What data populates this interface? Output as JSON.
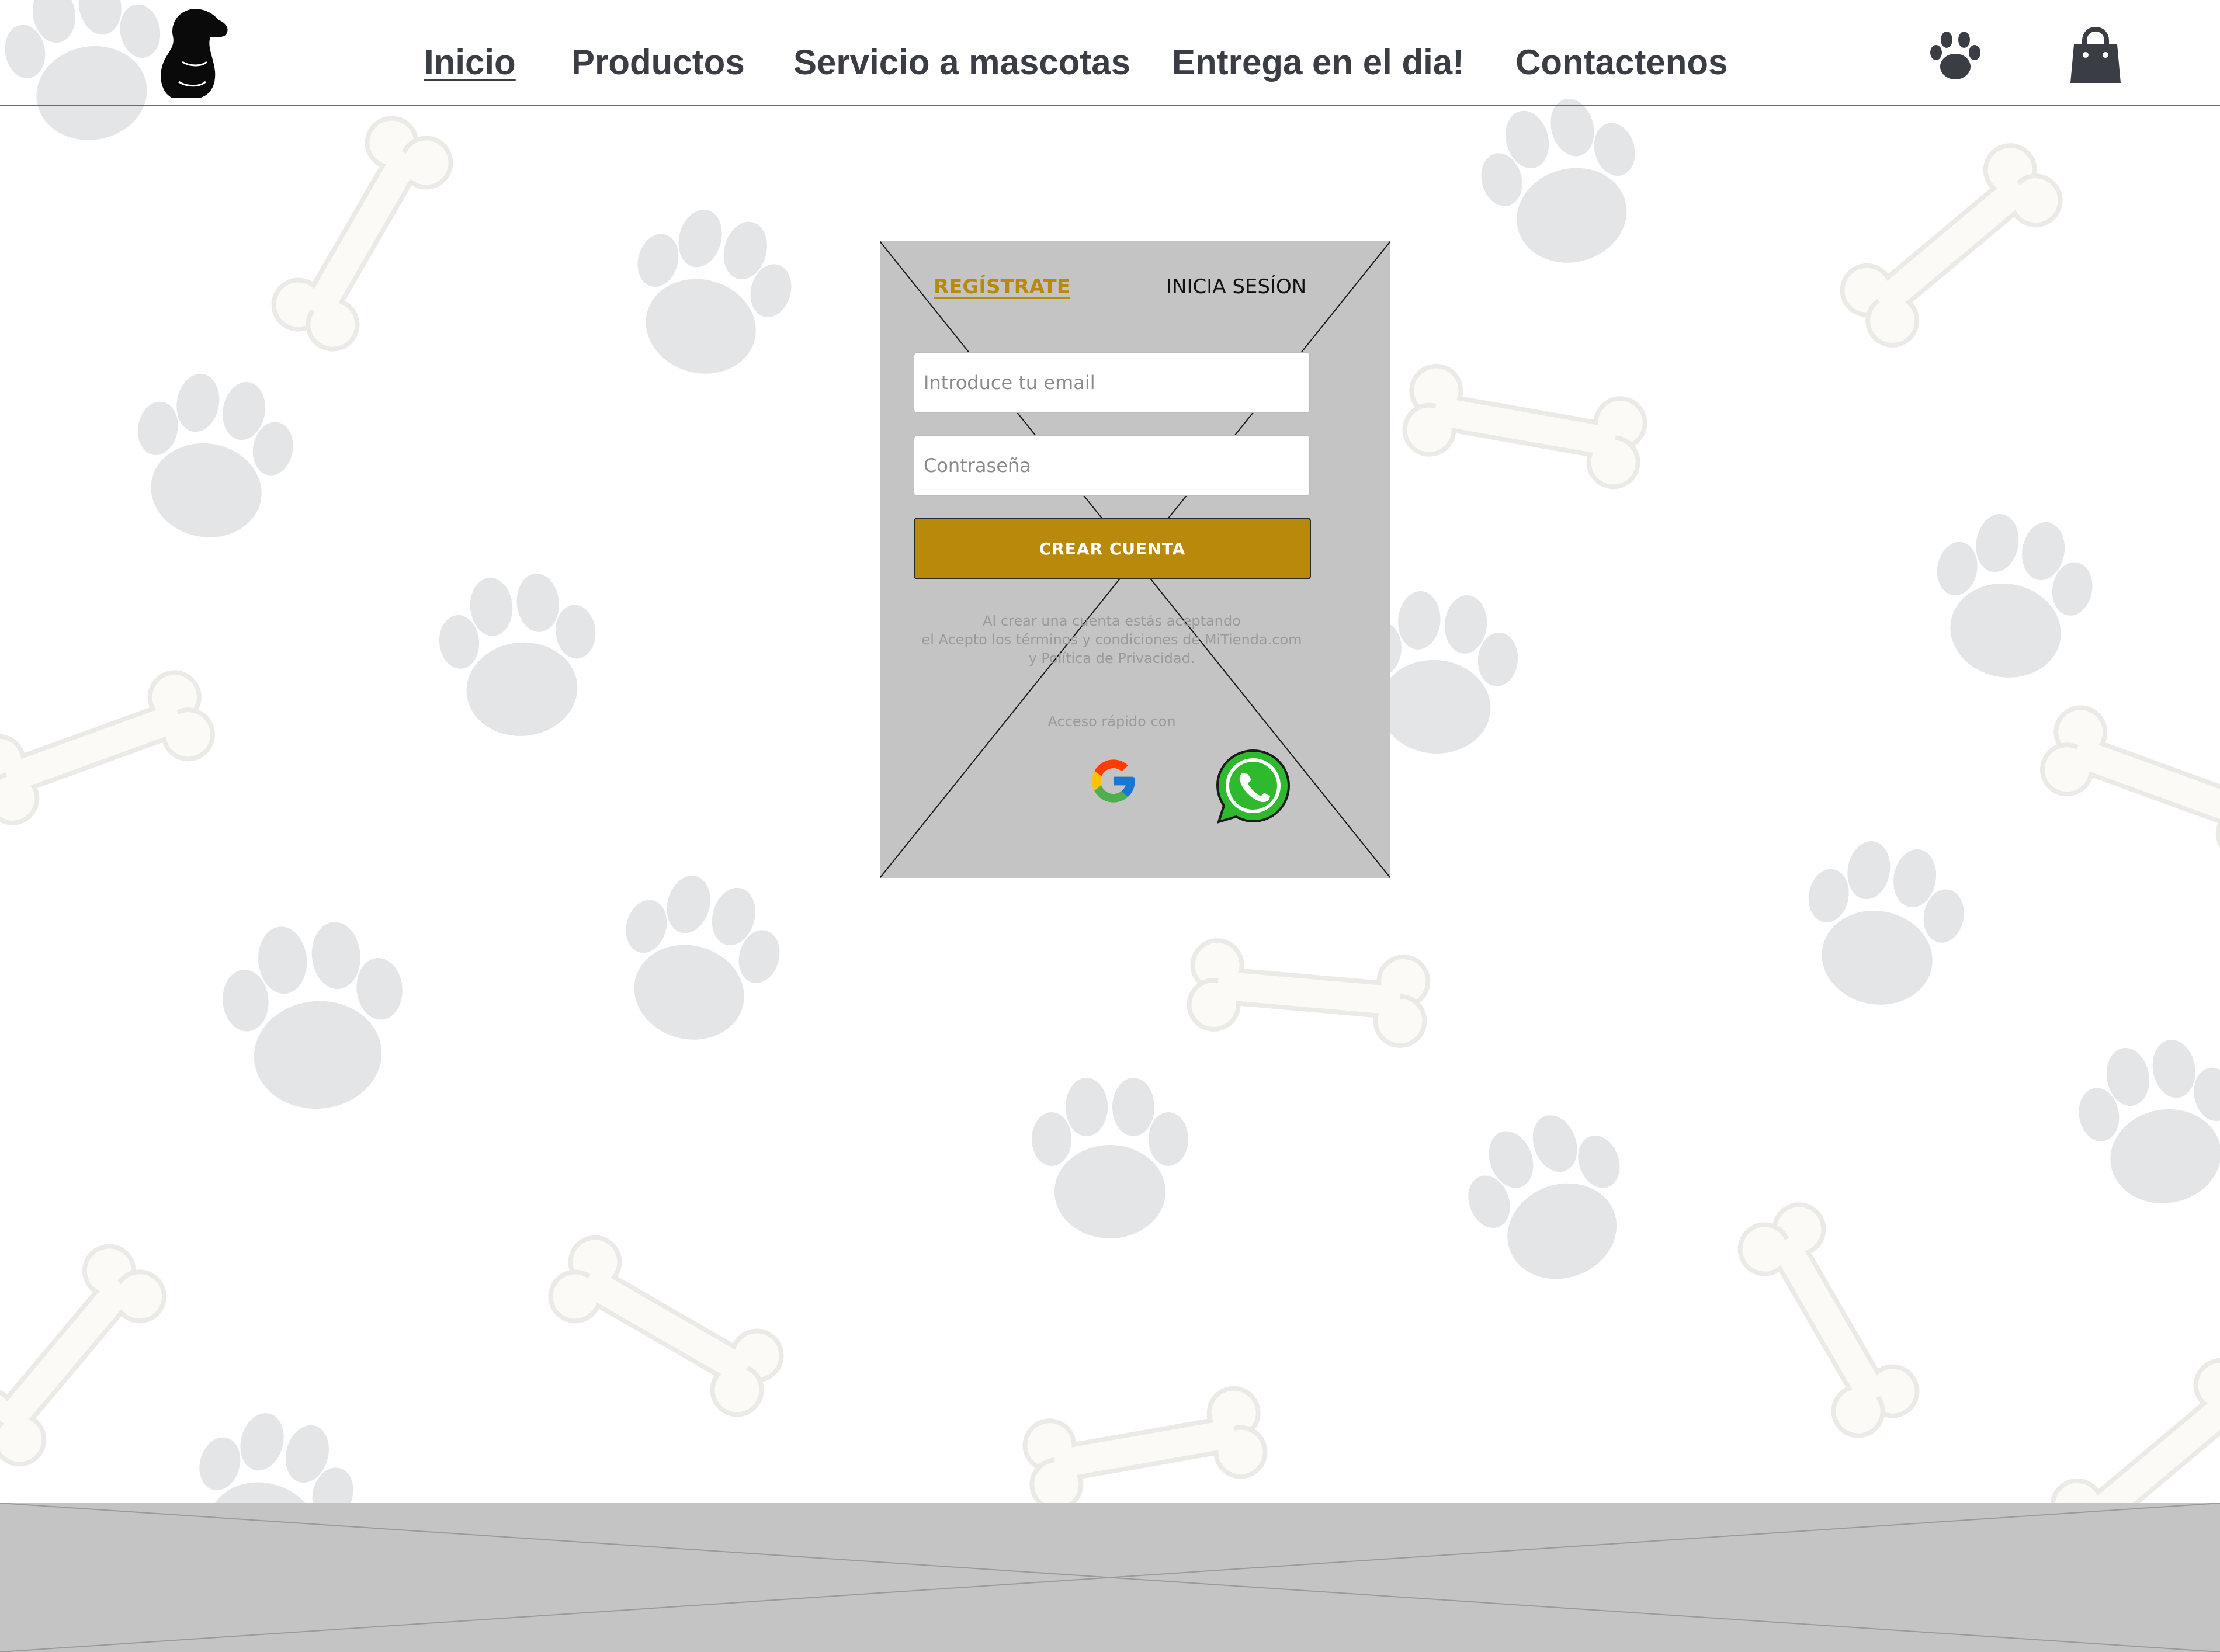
{
  "header": {
    "nav": [
      {
        "label": "Inicio",
        "active": true
      },
      {
        "label": "Productos",
        "active": false
      },
      {
        "label": "Servicio a mascotas",
        "active": false
      },
      {
        "label": "Entrega en el dia!",
        "active": false
      },
      {
        "label": "Contactenos",
        "active": false
      }
    ],
    "icons": [
      "dog-logo",
      "paw-icon",
      "shopping-bag-icon"
    ]
  },
  "login": {
    "tabs": {
      "register": "REGÍSTRATE",
      "login": "INICIA SESÍON"
    },
    "email_placeholder": "Introduce tu email",
    "password_placeholder": "Contraseña",
    "submit_label": "CREAR CUENTA",
    "terms": [
      "Al crear una cuenta estás aceptando",
      "el Acepto los términos y condiciones de MiTienda.com",
      "y Política de Privacidad."
    ],
    "quick_access": "Acceso rápido con",
    "social": [
      "google-icon",
      "whatsapp-icon"
    ]
  },
  "colors": {
    "accent": "#b8890a",
    "nav_text": "#3a3d44",
    "placeholder_gray": "#c4c4c4",
    "paw": "#e4e5e7",
    "bone": "#fbfaf7"
  }
}
